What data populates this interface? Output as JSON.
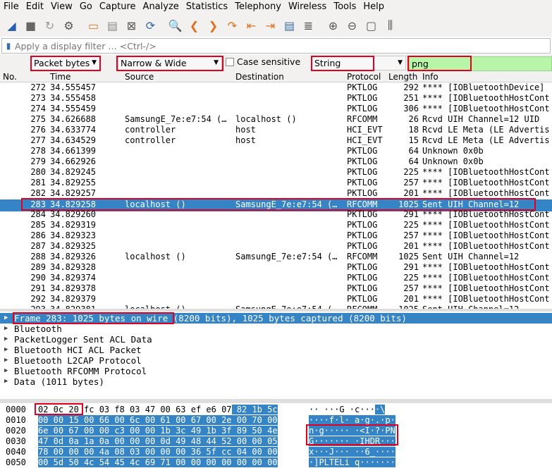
{
  "menu": [
    "File",
    "Edit",
    "View",
    "Go",
    "Capture",
    "Analyze",
    "Statistics",
    "Telephony",
    "Wireless",
    "Tools",
    "Help"
  ],
  "toolbar_icons": [
    "shark-fin-start-icon",
    "stop-icon",
    "restart-icon",
    "options-gear-icon",
    "open-folder-icon",
    "save-file-icon",
    "close-file-icon",
    "reload-icon",
    "find-icon",
    "go-back-icon",
    "go-forward-icon",
    "go-to-packet-icon",
    "go-first-icon",
    "go-last-icon",
    "autoscroll-icon",
    "colorize-icon",
    "zoom-in-icon",
    "zoom-out-icon",
    "zoom-normal-icon",
    "resize-columns-icon"
  ],
  "filter": {
    "placeholder": "Apply a display filter … <Ctrl-/>"
  },
  "find": {
    "search_in": "Packet bytes",
    "char_width": "Narrow & Wide",
    "case_label": "Case sensitive",
    "search_type": "String",
    "query": "png"
  },
  "columns": {
    "no": "No.",
    "time": "Time",
    "source": "Source",
    "destination": "Destination",
    "protocol": "Protocol",
    "length": "Length",
    "info": "Info"
  },
  "packets": [
    {
      "no": "272",
      "time": "34.555457",
      "src": "",
      "dst": "",
      "proto": "PKTLOG",
      "len": "292",
      "info": "**** [IOBluetoothDevice]"
    },
    {
      "no": "273",
      "time": "34.555458",
      "src": "",
      "dst": "",
      "proto": "PKTLOG",
      "len": "251",
      "info": "**** [IOBluetoothHostCont"
    },
    {
      "no": "274",
      "time": "34.555459",
      "src": "",
      "dst": "",
      "proto": "PKTLOG",
      "len": "306",
      "info": "**** [IOBluetoothHostCont"
    },
    {
      "no": "275",
      "time": "34.626688",
      "src": "SamsungE_7e:e7:54 (…",
      "dst": "localhost ()",
      "proto": "RFCOMM",
      "len": "26",
      "info": "Rcvd UIH Channel=12 UID"
    },
    {
      "no": "276",
      "time": "34.633774",
      "src": "controller",
      "dst": "host",
      "proto": "HCI_EVT",
      "len": "18",
      "info": "Rcvd LE Meta (LE Advertis"
    },
    {
      "no": "277",
      "time": "34.634529",
      "src": "controller",
      "dst": "host",
      "proto": "HCI_EVT",
      "len": "15",
      "info": "Rcvd LE Meta (LE Advertis"
    },
    {
      "no": "278",
      "time": "34.661399",
      "src": "",
      "dst": "",
      "proto": "PKTLOG",
      "len": "64",
      "info": "Unknown 0x0b"
    },
    {
      "no": "279",
      "time": "34.662926",
      "src": "",
      "dst": "",
      "proto": "PKTLOG",
      "len": "64",
      "info": "Unknown 0x0b"
    },
    {
      "no": "280",
      "time": "34.829245",
      "src": "",
      "dst": "",
      "proto": "PKTLOG",
      "len": "225",
      "info": "**** [IOBluetoothHostCont"
    },
    {
      "no": "281",
      "time": "34.829255",
      "src": "",
      "dst": "",
      "proto": "PKTLOG",
      "len": "257",
      "info": "**** [IOBluetoothHostCont"
    },
    {
      "no": "282",
      "time": "34.829257",
      "src": "",
      "dst": "",
      "proto": "PKTLOG",
      "len": "201",
      "info": "**** [IOBluetoothHostCont"
    },
    {
      "no": "283",
      "time": "34.829258",
      "src": "localhost ()",
      "dst": "SamsungE_7e:e7:54 (…",
      "proto": "RFCOMM",
      "len": "1025",
      "info": "Sent UIH Channel=12"
    },
    {
      "no": "284",
      "time": "34.829260",
      "src": "",
      "dst": "",
      "proto": "PKTLOG",
      "len": "291",
      "info": "**** [IOBluetoothHostCont"
    },
    {
      "no": "285",
      "time": "34.829319",
      "src": "",
      "dst": "",
      "proto": "PKTLOG",
      "len": "225",
      "info": "**** [IOBluetoothHostCont"
    },
    {
      "no": "286",
      "time": "34.829323",
      "src": "",
      "dst": "",
      "proto": "PKTLOG",
      "len": "257",
      "info": "**** [IOBluetoothHostCont"
    },
    {
      "no": "287",
      "time": "34.829325",
      "src": "",
      "dst": "",
      "proto": "PKTLOG",
      "len": "201",
      "info": "**** [IOBluetoothHostCont"
    },
    {
      "no": "288",
      "time": "34.829326",
      "src": "localhost ()",
      "dst": "SamsungE_7e:e7:54 (…",
      "proto": "RFCOMM",
      "len": "1025",
      "info": "Sent UIH Channel=12"
    },
    {
      "no": "289",
      "time": "34.829328",
      "src": "",
      "dst": "",
      "proto": "PKTLOG",
      "len": "291",
      "info": "**** [IOBluetoothHostCont"
    },
    {
      "no": "290",
      "time": "34.829374",
      "src": "",
      "dst": "",
      "proto": "PKTLOG",
      "len": "225",
      "info": "**** [IOBluetoothHostCont"
    },
    {
      "no": "291",
      "time": "34.829378",
      "src": "",
      "dst": "",
      "proto": "PKTLOG",
      "len": "257",
      "info": "**** [IOBluetoothHostCont"
    },
    {
      "no": "292",
      "time": "34.829379",
      "src": "",
      "dst": "",
      "proto": "PKTLOG",
      "len": "201",
      "info": "**** [IOBluetoothHostCont"
    },
    {
      "no": "293",
      "time": "34.829381",
      "src": "localhost ()",
      "dst": "SamsungE_7e:e7:54 (…",
      "proto": "RFCOMM",
      "len": "1025",
      "info": "Sent UIH Channel=12"
    }
  ],
  "selected_packet_index": 11,
  "details": {
    "frame_boxed": "Frame 283: 1025 bytes on wire",
    "frame_rest": " (8200 bits), 1025 bytes captured (8200 bits)",
    "items": [
      "Bluetooth",
      "PacketLogger Sent ACL Data",
      "Bluetooth HCI ACL Packet",
      "Bluetooth L2CAP Protocol",
      "Bluetooth RFCOMM Protocol",
      "Data (1011 bytes)"
    ]
  },
  "bytes": [
    {
      "off": "0000",
      "hex_a": "02 0c 20 fc 03 f8 03 47  00 63 ef e6 07",
      "hex_b": " 82 1b 5c",
      "asc_a": "·· ···G ·c···",
      "asc_b": "·\\"
    },
    {
      "off": "0010",
      "hex_a": "",
      "hex_b": "00 00 15 00 66 00 6c 00  61 00 67 00 2e 00 70 00",
      "asc_a": "",
      "asc_b": "····f·l· a·g·.·p·"
    },
    {
      "off": "0020",
      "hex_a": "",
      "hex_b": "6e 00 67 00 00 c3 00 00  1b 3c 49 1b 3f 89 50 4e",
      "asc_a": "",
      "asc_b": "n·g····· ·<I·?·PN"
    },
    {
      "off": "0030",
      "hex_a": "",
      "hex_b": "47 0d 0a 1a 0a 00 00 00  0d 49 48 44 52 00 00 05",
      "asc_a": "",
      "asc_b": "G······· ·IHDR···"
    },
    {
      "off": "0040",
      "hex_a": "",
      "hex_b": "78 00 00 00 4a 08 03 00  00 00 36 5f cc 04 00 00",
      "asc_a": "",
      "asc_b": "x···J··· ··6_····"
    },
    {
      "off": "0050",
      "hex_a": "",
      "hex_b": "00 5d 50 4c 54 45 4c 69  71 00 00 00 00 00 00 00",
      "asc_a": "",
      "asc_b": "·]PLTELi q·······"
    }
  ]
}
